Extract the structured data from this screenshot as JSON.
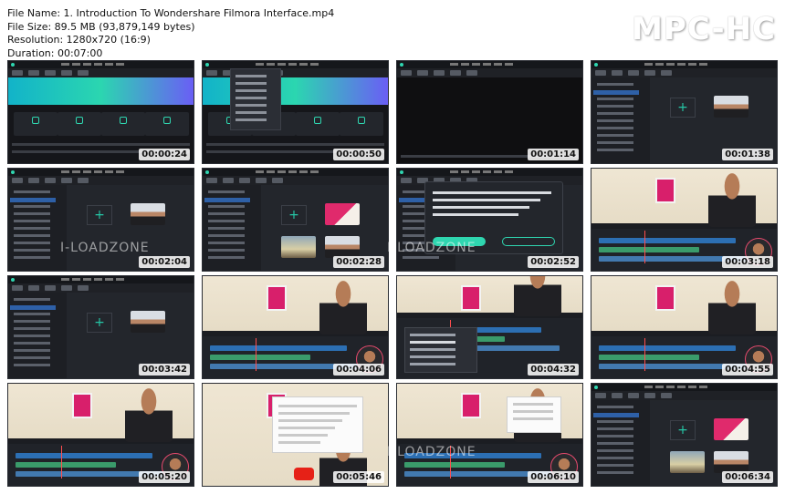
{
  "header": {
    "file_name": "File Name: 1. Introduction To Wondershare Filmora Interface.mp4",
    "file_size": "File Size: 89.5 MB (93,879,149 bytes)",
    "resolution": "Resolution: 1280x720 (16:9)",
    "duration": "Duration: 00:07:00"
  },
  "logo": "MPC-HC",
  "watermark": "I-LOADZONE",
  "timestamps": [
    "00:00:24",
    "00:00:50",
    "00:01:14",
    "00:01:38",
    "00:02:04",
    "00:02:28",
    "00:02:52",
    "00:03:18",
    "00:03:42",
    "00:04:06",
    "00:04:32",
    "00:04:55",
    "00:05:20",
    "00:05:46",
    "00:06:10",
    "00:06:34"
  ],
  "thumb_kinds": [
    "welcome",
    "welcome-dropdown",
    "player-black",
    "editor-media",
    "editor-media",
    "editor-media-pink",
    "editor-dialog",
    "editor-video",
    "editor-media",
    "editor-video",
    "editor-menu",
    "editor-video",
    "editor-video",
    "browser-video",
    "editor-video-page",
    "editor-media-pink"
  ],
  "colors": {
    "accent": "#2fd6b0",
    "panel": "#1b1d22",
    "timestamp_bg": "#ffffff"
  }
}
